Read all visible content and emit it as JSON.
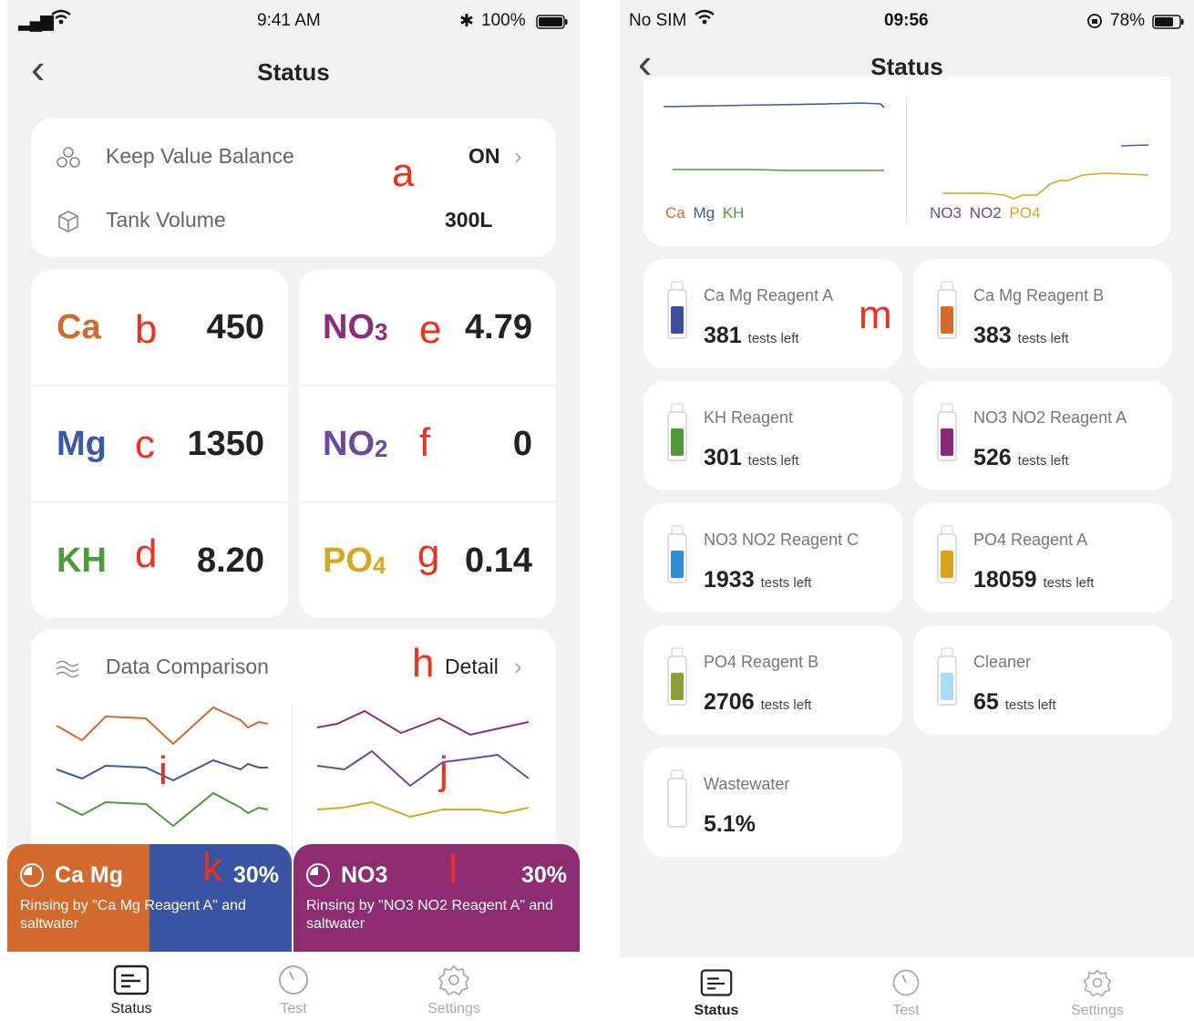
{
  "left": {
    "status_bar": {
      "signal": "▂▄▆",
      "time": "9:41 AM",
      "battery": "100%",
      "bluetooth": "✱"
    },
    "nav": {
      "title": "Status",
      "back": "‹"
    },
    "settings_card": {
      "keep_value_label": "Keep Value Balance",
      "keep_value_state": "ON",
      "tank_volume_label": "Tank Volume",
      "tank_volume_value": "300L"
    },
    "params_left": [
      {
        "name": "Ca",
        "sub": "",
        "value": "450",
        "color": "#d2692d"
      },
      {
        "name": "Mg",
        "sub": "",
        "value": "1350",
        "color": "#3c58a8"
      },
      {
        "name": "KH",
        "sub": "",
        "value": "8.20",
        "color": "#4d9a3a"
      }
    ],
    "params_right": [
      {
        "name": "NO",
        "sub": "3",
        "value": "4.79",
        "color": "#8d2c78"
      },
      {
        "name": "NO",
        "sub": "2",
        "value": "0",
        "color": "#6a4aa0"
      },
      {
        "name": "PO",
        "sub": "4",
        "value": "0.14",
        "color": "#d6a81e"
      }
    ],
    "comparison": {
      "title": "Data Comparison",
      "detail": "Detail"
    },
    "banners": [
      {
        "title": "Ca Mg",
        "percent": "30%",
        "desc": "Rinsing by \"Ca Mg Reagent A\" and saltwater"
      },
      {
        "title": "NO3",
        "percent": "30%",
        "desc": "Rinsing by \"NO3 NO2 Reagent A\" and saltwater"
      }
    ],
    "tabs": {
      "status": "Status",
      "test": "Test",
      "settings": "Settings"
    },
    "annotations": {
      "a": "a",
      "b": "b",
      "c": "c",
      "d": "d",
      "e": "e",
      "f": "f",
      "g": "g",
      "h": "h",
      "i": "i",
      "j": "j",
      "k": "k",
      "l": "l"
    }
  },
  "right": {
    "status_bar": {
      "carrier": "No SIM",
      "time": "09:56",
      "battery": "78%"
    },
    "nav": {
      "title": "Status",
      "back": "‹"
    },
    "legend_left": [
      "Ca",
      "Mg",
      "KH"
    ],
    "legend_right": [
      "NO3",
      "NO2",
      "PO4"
    ],
    "reagents": [
      {
        "name": "Ca Mg Reagent A",
        "count": "381",
        "unit": "tests left",
        "color": "#3b4f9c"
      },
      {
        "name": "Ca Mg Reagent B",
        "count": "383",
        "unit": "tests left",
        "color": "#d66a2c"
      },
      {
        "name": "KH Reagent",
        "count": "301",
        "unit": "tests left",
        "color": "#4c9a3b"
      },
      {
        "name": "NO3 NO2 Reagent A",
        "count": "526",
        "unit": "tests left",
        "color": "#8c2877"
      },
      {
        "name": "NO3 NO2 Reagent C",
        "count": "1933",
        "unit": "tests left",
        "color": "#2f8fd3"
      },
      {
        "name": "PO4 Reagent A",
        "count": "18059",
        "unit": "tests left",
        "color": "#d9a41c"
      },
      {
        "name": "PO4 Reagent B",
        "count": "2706",
        "unit": "tests left",
        "color": "#8a9e3a"
      },
      {
        "name": "Cleaner",
        "count": "65",
        "unit": "tests left",
        "color": "#a8dcf5"
      },
      {
        "name": "Wastewater",
        "count": "5.1%",
        "unit": "",
        "color": "#ffffff"
      }
    ],
    "tabs": {
      "status": "Status",
      "test": "Test",
      "settings": "Settings"
    },
    "annotation_m": "m"
  }
}
